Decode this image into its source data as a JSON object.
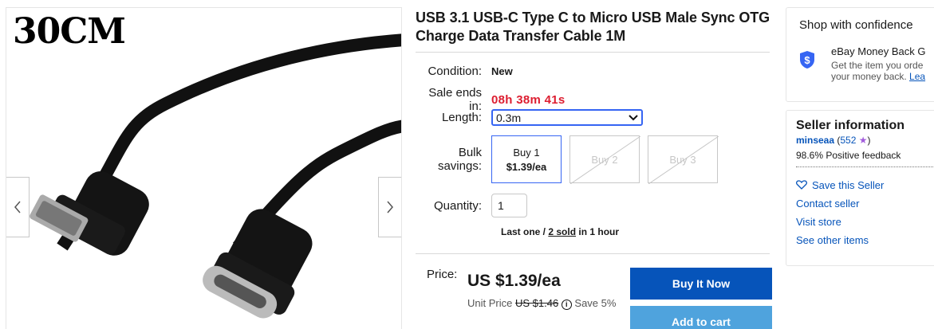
{
  "gallery": {
    "photo_text": "30CM",
    "prev_icon": "chevron-left-icon",
    "next_icon": "chevron-right-icon"
  },
  "listing": {
    "title": "USB 3.1 USB-C Type C to Micro USB Male Sync OTG Charge Data Transfer Cable 1M",
    "condition_label": "Condition:",
    "condition_value": "New",
    "sale_label": "Sale ends in:",
    "sale_countdown": "08h 38m 41s",
    "length_label": "Length:",
    "length_selected": "0.3m",
    "bulk_label": "Bulk savings:",
    "bulk_options": [
      {
        "label": "Buy 1",
        "price": "$1.39/ea",
        "selected": true
      },
      {
        "label": "Buy 2",
        "price": "",
        "selected": false
      },
      {
        "label": "Buy 3",
        "price": "",
        "selected": false
      }
    ],
    "quantity_label": "Quantity:",
    "quantity_value": "1",
    "stock_prefix": "Last one / ",
    "stock_sold": "2 sold",
    "stock_suffix": " in 1 hour",
    "price_label": "Price:",
    "price_value": "US $1.39/ea",
    "unit_prefix": "Unit Price ",
    "unit_strike": "US $1.46",
    "unit_save": " Save 5%",
    "buy_now": "Buy It Now",
    "add_to_cart": "Add to cart"
  },
  "confidence": {
    "heading": "Shop with confidence",
    "mbg_title": "eBay Money Back G",
    "mbg_desc_1": "Get the item you orde",
    "mbg_desc_2_prefix": "your money back. ",
    "mbg_desc_2_link": "Lea"
  },
  "seller": {
    "heading": "Seller information",
    "name": "minseaa",
    "count_open": " (",
    "count": "552",
    "count_close": ")",
    "feedback": "98.6% Positive feedback",
    "save_seller": "Save this Seller",
    "contact": "Contact seller",
    "visit": "Visit store",
    "other": "See other items"
  },
  "colors": {
    "primary_button": "#0654ba",
    "secondary_button": "#4fa3dd",
    "countdown": "#dd1e31",
    "link": "#0654ba",
    "select_border": "#3665f3"
  }
}
